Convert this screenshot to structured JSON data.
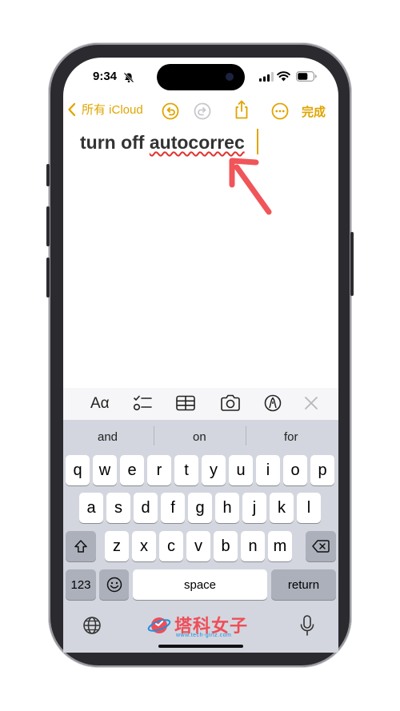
{
  "status_bar": {
    "time": "9:34"
  },
  "nav": {
    "back_label": "所有 iCloud",
    "done_label": "完成"
  },
  "note": {
    "text_plain": "turn off ",
    "text_misspelled": "autocorrec"
  },
  "format_bar": {
    "text_style_label": "Aα"
  },
  "suggestions": [
    "and",
    "on",
    "for"
  ],
  "keyboard": {
    "row1": [
      "q",
      "w",
      "e",
      "r",
      "t",
      "y",
      "u",
      "i",
      "o",
      "p"
    ],
    "row2": [
      "a",
      "s",
      "d",
      "f",
      "g",
      "h",
      "j",
      "k",
      "l"
    ],
    "row3": [
      "z",
      "x",
      "c",
      "v",
      "b",
      "n",
      "m"
    ],
    "numbers_label": "123",
    "space_label": "space",
    "return_label": "return"
  },
  "watermark": {
    "brand": "塔科女子",
    "url": "www.tech-girlz.com"
  },
  "colors": {
    "accent": "#e0a400",
    "annotation_arrow": "#f0555a",
    "spell_underline": "#e0342f"
  }
}
